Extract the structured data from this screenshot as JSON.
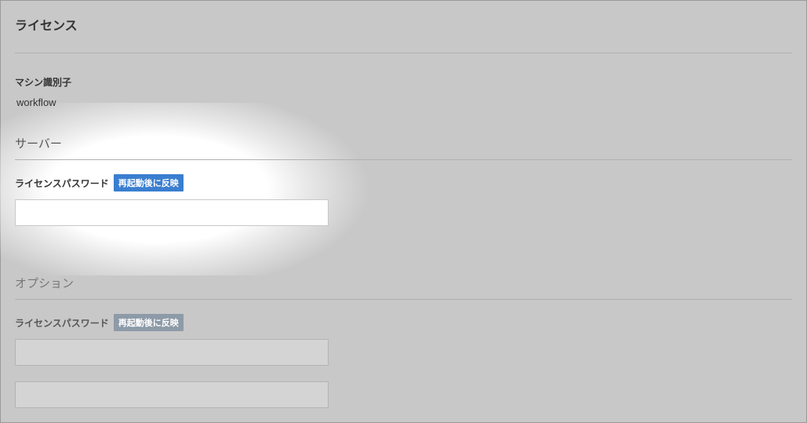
{
  "page": {
    "title": "ライセンス"
  },
  "machineId": {
    "label": "マシン識別子",
    "value": "workflow"
  },
  "server": {
    "heading": "サーバー",
    "licensePassword": {
      "label": "ライセンスパスワード",
      "badge": "再起動後に反映",
      "value": ""
    }
  },
  "option": {
    "heading": "オプション",
    "licensePassword": {
      "label": "ライセンスパスワード",
      "badge": "再起動後に反映",
      "value": ""
    },
    "secondField": {
      "value": ""
    }
  }
}
